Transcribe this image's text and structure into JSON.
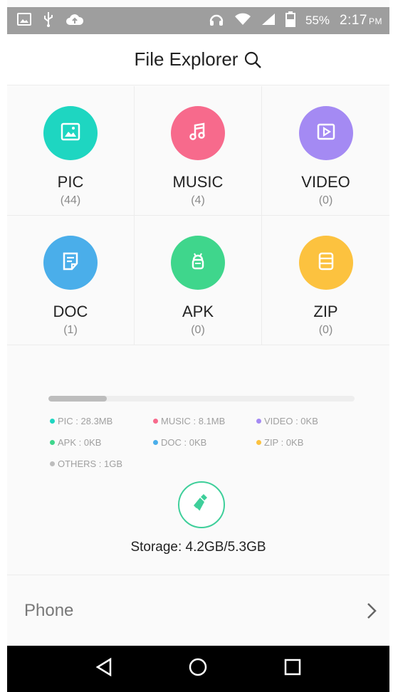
{
  "status_bar": {
    "battery": "55%",
    "time": "2:17",
    "ampm": "PM"
  },
  "header": {
    "title": "File Explorer"
  },
  "categories": [
    {
      "label": "PIC",
      "count": "(44)",
      "color": "#1ed6c1",
      "icon": "image-icon"
    },
    {
      "label": "MUSIC",
      "count": "(4)",
      "color": "#f76a8c",
      "icon": "music-note-icon"
    },
    {
      "label": "VIDEO",
      "count": "(0)",
      "color": "#a48af3",
      "icon": "play-icon"
    },
    {
      "label": "DOC",
      "count": "(1)",
      "color": "#4aaeea",
      "icon": "document-icon"
    },
    {
      "label": "APK",
      "count": "(0)",
      "color": "#3fd68c",
      "icon": "android-icon"
    },
    {
      "label": "ZIP",
      "count": "(0)",
      "color": "#fcc23f",
      "icon": "archive-icon"
    }
  ],
  "storage": {
    "used_fraction": 0.19,
    "legend": [
      {
        "label": "PIC : 28.3MB",
        "color": "#1ed6c1"
      },
      {
        "label": "MUSIC : 8.1MB",
        "color": "#f76a8c"
      },
      {
        "label": "VIDEO : 0KB",
        "color": "#a48af3"
      },
      {
        "label": "APK : 0KB",
        "color": "#3fd68c"
      },
      {
        "label": "DOC : 0KB",
        "color": "#4aaeea"
      },
      {
        "label": "ZIP : 0KB",
        "color": "#fcc23f"
      },
      {
        "label": "OTHERS : 1GB",
        "color": "#bdbdbd"
      }
    ],
    "summary": "Storage: 4.2GB/5.3GB"
  },
  "phone": {
    "label": "Phone"
  }
}
